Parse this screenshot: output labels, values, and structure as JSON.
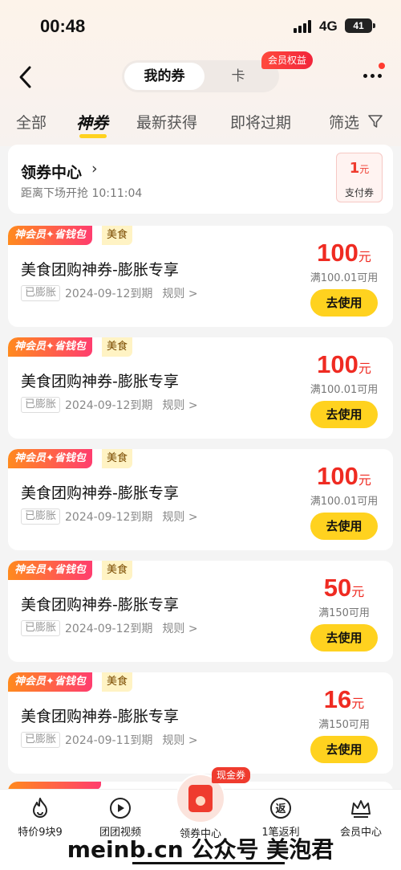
{
  "status_bar": {
    "time": "00:48",
    "network": "4G",
    "battery": "41"
  },
  "header": {
    "segment_active": "我的券",
    "segment_other": "卡",
    "member_badge": "会员权益"
  },
  "tabs": [
    {
      "label": "全部"
    },
    {
      "label": "神券"
    },
    {
      "label": "最新获得"
    },
    {
      "label": "即将过期"
    },
    {
      "label": "筛选"
    }
  ],
  "coupon_center": {
    "title": "领券中心",
    "subtitle": "距离下场开抢 10:11:04",
    "pay_amount": "1",
    "pay_unit": "元",
    "pay_label": "支付券"
  },
  "coupons": [
    {
      "vip_tag": "神会员✦省钱包",
      "category": "美食",
      "title": "美食团购神券-膨胀专享",
      "status": "已膨胀",
      "expiry": "2024-09-12到期",
      "rule": "规则 >",
      "amount": "100",
      "unit": "元",
      "threshold": "满100.01可用",
      "button": "去使用"
    },
    {
      "vip_tag": "神会员✦省钱包",
      "category": "美食",
      "title": "美食团购神券-膨胀专享",
      "status": "已膨胀",
      "expiry": "2024-09-12到期",
      "rule": "规则 >",
      "amount": "100",
      "unit": "元",
      "threshold": "满100.01可用",
      "button": "去使用"
    },
    {
      "vip_tag": "神会员✦省钱包",
      "category": "美食",
      "title": "美食团购神券-膨胀专享",
      "status": "已膨胀",
      "expiry": "2024-09-12到期",
      "rule": "规则 >",
      "amount": "100",
      "unit": "元",
      "threshold": "满100.01可用",
      "button": "去使用"
    },
    {
      "vip_tag": "神会员✦省钱包",
      "category": "美食",
      "title": "美食团购神券-膨胀专享",
      "status": "已膨胀",
      "expiry": "2024-09-12到期",
      "rule": "规则 >",
      "amount": "50",
      "unit": "元",
      "threshold": "满150可用",
      "button": "去使用"
    },
    {
      "vip_tag": "神会员✦省钱包",
      "category": "美食",
      "title": "美食团购神券-膨胀专享",
      "status": "已膨胀",
      "expiry": "2024-09-11到期",
      "rule": "规则 >",
      "amount": "16",
      "unit": "元",
      "threshold": "满150可用",
      "button": "去使用"
    }
  ],
  "bottom_nav": [
    {
      "label": "特价9块9",
      "icon": "flame-icon"
    },
    {
      "label": "团团视频",
      "icon": "play-icon"
    },
    {
      "label": "领券中心",
      "icon": "red-envelope-icon"
    },
    {
      "label": "1笔返利",
      "icon": "rebate-icon"
    },
    {
      "label": "会员中心",
      "icon": "crown-icon"
    }
  ],
  "cash_badge": "现金券",
  "watermark": "meinb.cn 公众号 美泡君",
  "colors": {
    "accent_yellow": "#ffd21f",
    "price_red": "#ef2b22",
    "badge_red": "#ef3b2e"
  }
}
